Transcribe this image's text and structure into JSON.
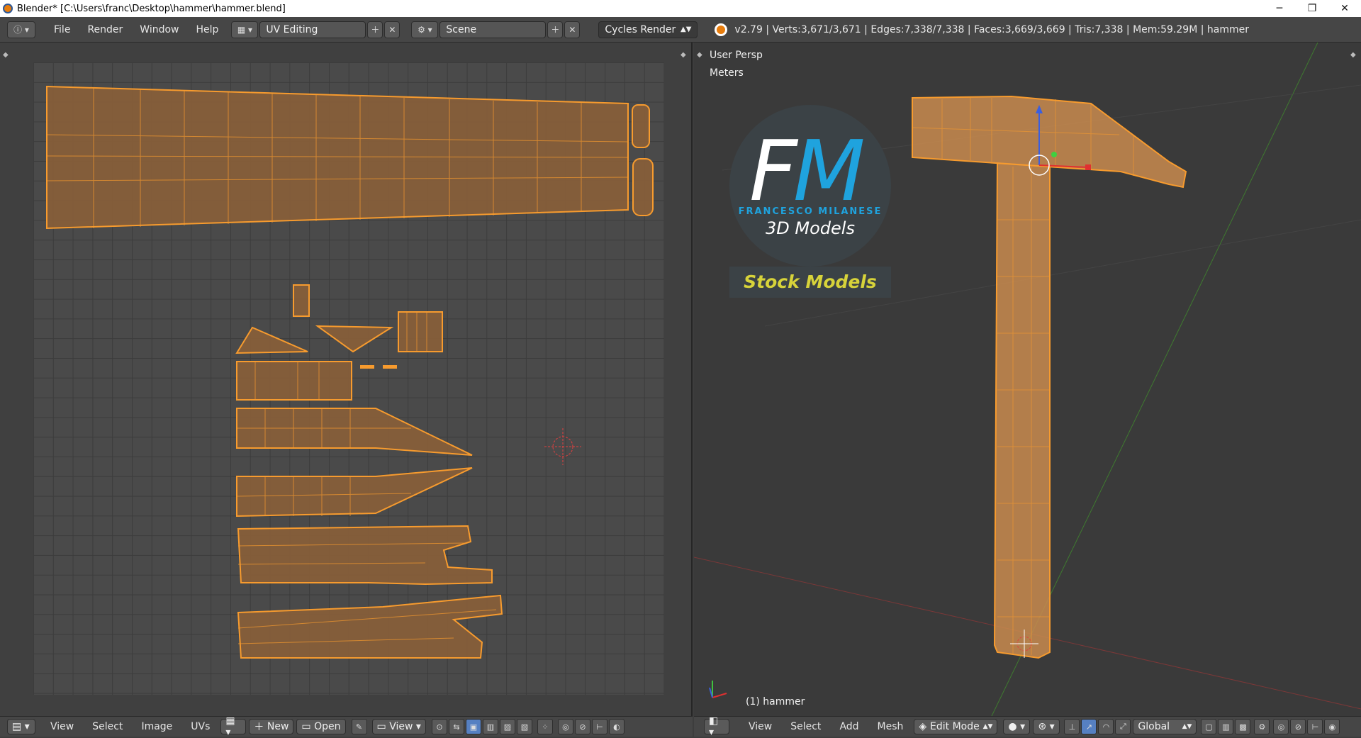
{
  "window": {
    "title": "Blender* [C:\\Users\\franc\\Desktop\\hammer\\hammer.blend]",
    "min": "─",
    "max": "❐",
    "close": "✕"
  },
  "topbar": {
    "menus": [
      "File",
      "Render",
      "Window",
      "Help"
    ],
    "layout": "UV Editing",
    "scene": "Scene",
    "engine": "Cycles Render",
    "stats": "v2.79 | Verts:3,671/3,671 | Edges:7,338/7,338 | Faces:3,669/3,669 | Tris:7,338 | Mem:59.29M | hammer"
  },
  "uv_editor": {
    "menus": [
      "View",
      "Select",
      "Image",
      "UVs"
    ],
    "new_label": "New",
    "open_label": "Open",
    "view_label": "View"
  },
  "viewport": {
    "persp": "User Persp",
    "units": "Meters",
    "object": "(1) hammer",
    "menus": [
      "View",
      "Select",
      "Add",
      "Mesh"
    ],
    "mode": "Edit Mode",
    "orientation": "Global"
  },
  "logo": {
    "f": "F",
    "m": "M",
    "author": "FRANCESCO MILANESE",
    "tagline": "3D Models",
    "stock": "Stock Models"
  },
  "colors": {
    "accent": "#f79b2e",
    "uv_fill": "#8a5f38",
    "header": "#464646",
    "viewport_bg": "#3a3a3a"
  }
}
